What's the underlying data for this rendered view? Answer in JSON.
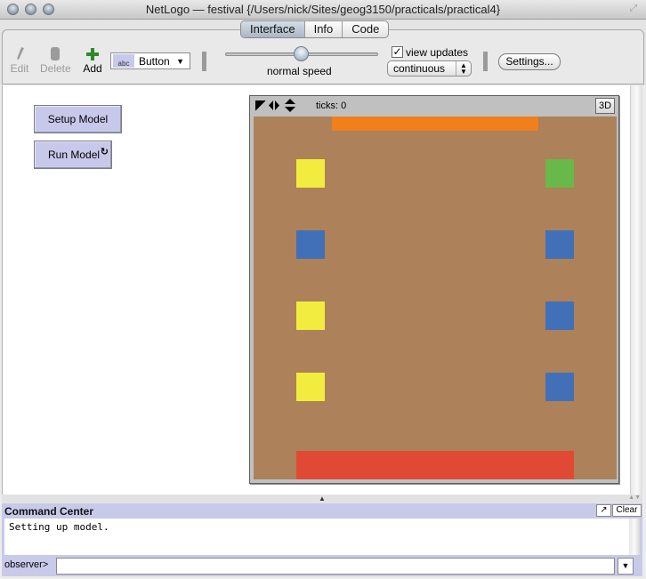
{
  "window": {
    "title": "NetLogo — festival {/Users/nick/Sites/geog3150/practicals/practical4}"
  },
  "tabs": [
    {
      "label": "Interface",
      "active": true
    },
    {
      "label": "Info",
      "active": false
    },
    {
      "label": "Code",
      "active": false
    }
  ],
  "toolbar": {
    "edit_label": "Edit",
    "delete_label": "Delete",
    "add_label": "Add",
    "widget_type": "Button",
    "widget_type_icon": "abc",
    "speed_label": "normal speed",
    "speed_value": 0.5,
    "view_updates_label": "view updates",
    "view_updates_checked": true,
    "update_mode": "continuous",
    "settings_label": "Settings..."
  },
  "buttons": [
    {
      "label": "Setup Model",
      "forever": false
    },
    {
      "label": "Run Model",
      "forever": true,
      "forever_icon": "↻"
    }
  ],
  "view": {
    "ticks_label": "ticks: 0",
    "btn_3d_label": "3D",
    "controls": "◩◀▶▲▼",
    "background_color": "#ad8159",
    "patches": [
      {
        "name": "stage-top",
        "color": "#f07f1c",
        "x0": 0.216,
        "y0": 0.0,
        "x1": 0.784,
        "y1": 0.039
      },
      {
        "name": "stall-left-1",
        "color": "#f2ec3e",
        "x0": 0.118,
        "y0": 0.118,
        "x1": 0.196,
        "y1": 0.196
      },
      {
        "name": "stall-right-1",
        "color": "#69b84a",
        "x0": 0.804,
        "y0": 0.118,
        "x1": 0.882,
        "y1": 0.196
      },
      {
        "name": "stall-left-2",
        "color": "#4170b8",
        "x0": 0.118,
        "y0": 0.314,
        "x1": 0.196,
        "y1": 0.392
      },
      {
        "name": "stall-right-2",
        "color": "#4170b8",
        "x0": 0.804,
        "y0": 0.314,
        "x1": 0.882,
        "y1": 0.392
      },
      {
        "name": "stall-left-3",
        "color": "#f2ec3e",
        "x0": 0.118,
        "y0": 0.51,
        "x1": 0.196,
        "y1": 0.588
      },
      {
        "name": "stall-right-3",
        "color": "#4170b8",
        "x0": 0.804,
        "y0": 0.51,
        "x1": 0.882,
        "y1": 0.588
      },
      {
        "name": "stall-left-4",
        "color": "#f2ec3e",
        "x0": 0.118,
        "y0": 0.706,
        "x1": 0.196,
        "y1": 0.784
      },
      {
        "name": "stall-right-4",
        "color": "#4170b8",
        "x0": 0.804,
        "y0": 0.706,
        "x1": 0.882,
        "y1": 0.784
      },
      {
        "name": "entrance-bottom",
        "color": "#e04a35",
        "x0": 0.118,
        "y0": 0.922,
        "x1": 0.882,
        "y1": 1.0
      }
    ]
  },
  "command_center": {
    "title": "Command Center",
    "clear_label": "Clear",
    "output": "Setting up model.",
    "prompt": "observer>",
    "input_value": ""
  }
}
